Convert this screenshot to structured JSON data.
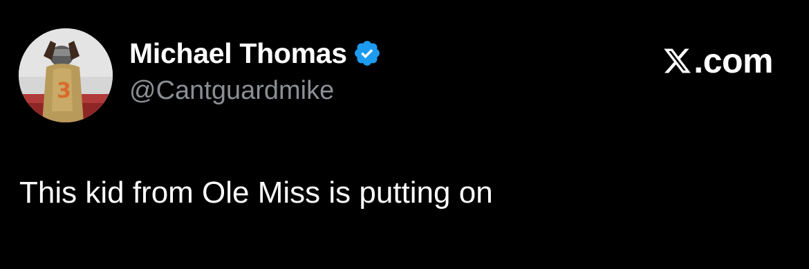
{
  "tweet": {
    "author": {
      "display_name": "Michael Thomas",
      "handle": "@Cantguardmike",
      "verified": true,
      "verified_icon": "verified-badge-icon",
      "avatar_icon": "avatar-photo"
    },
    "brand": {
      "logo_icon": "x-logo-icon",
      "text": ".com"
    },
    "text": "This kid from Ole Miss is putting on"
  },
  "colors": {
    "background": "#000000",
    "name": "#ffffff",
    "handle": "#8b8f94",
    "body_text": "#ffffff",
    "verified_badge": "#1d9bf0"
  }
}
